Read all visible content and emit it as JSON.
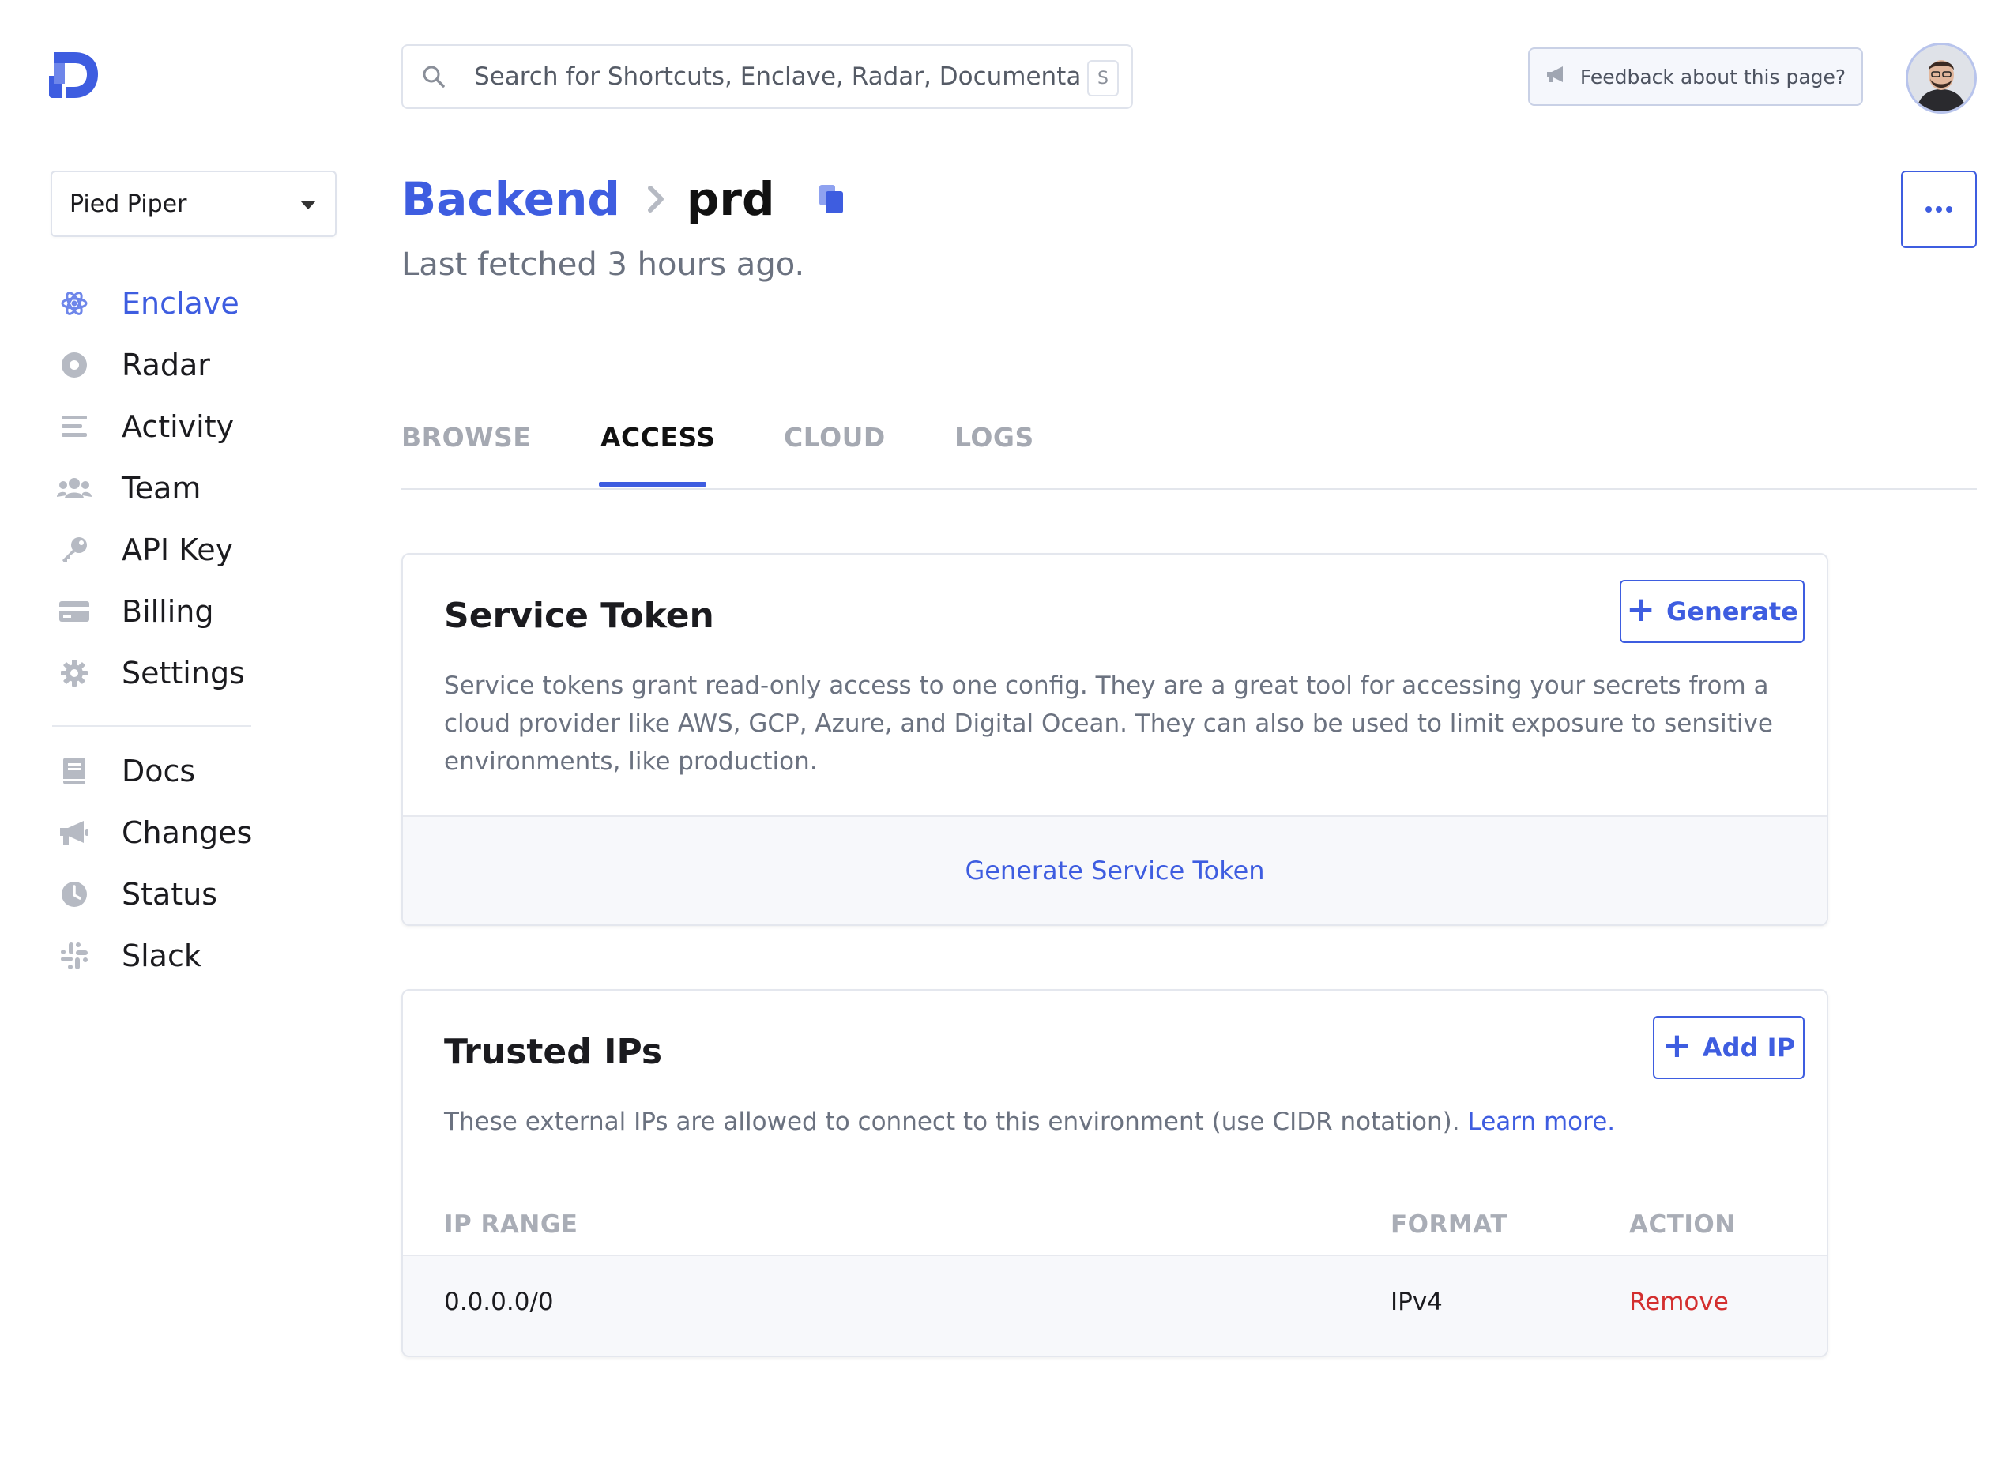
{
  "search": {
    "placeholder": "Search for Shortcuts, Enclave, Radar, Documentation...",
    "shortcut": "S"
  },
  "header": {
    "feedback_label": "Feedback about this page?"
  },
  "org_selector": {
    "selected": "Pied Piper"
  },
  "sidebar": {
    "items": [
      {
        "label": "Enclave",
        "icon": "atom-icon",
        "active": true
      },
      {
        "label": "Radar",
        "icon": "radar-icon"
      },
      {
        "label": "Activity",
        "icon": "activity-list-icon"
      },
      {
        "label": "Team",
        "icon": "team-icon"
      },
      {
        "label": "API Key",
        "icon": "key-icon"
      },
      {
        "label": "Billing",
        "icon": "credit-card-icon"
      },
      {
        "label": "Settings",
        "icon": "gear-icon"
      }
    ],
    "secondary": [
      {
        "label": "Docs",
        "icon": "book-icon"
      },
      {
        "label": "Changes",
        "icon": "megaphone-icon"
      },
      {
        "label": "Status",
        "icon": "clock-icon"
      },
      {
        "label": "Slack",
        "icon": "slack-icon"
      }
    ]
  },
  "breadcrumb": {
    "project": "Backend",
    "environment": "prd"
  },
  "last_fetched": "Last fetched 3 hours ago.",
  "tabs": [
    {
      "label": "BROWSE"
    },
    {
      "label": "ACCESS",
      "active": true
    },
    {
      "label": "CLOUD"
    },
    {
      "label": "LOGS"
    }
  ],
  "service_token": {
    "title": "Service Token",
    "button": "Generate",
    "description": "Service tokens grant read-only access to one config. They are a great tool for accessing your secrets from a cloud provider like AWS, GCP, Azure, and Digital Ocean. They can also be used to limit exposure to sensitive environments, like production.",
    "footer_link": "Generate Service Token"
  },
  "trusted_ips": {
    "title": "Trusted IPs",
    "button": "Add IP",
    "description": "These external IPs are allowed to connect to this environment (use CIDR notation).",
    "learn_more": "Learn more.",
    "columns": [
      "IP RANGE",
      "FORMAT",
      "ACTION"
    ],
    "rows": [
      {
        "ip_range": "0.0.0.0/0",
        "format": "IPv4",
        "action": "Remove"
      }
    ]
  },
  "colors": {
    "accent": "#3e5de0",
    "danger": "#d32f2f",
    "muted": "#6b7280"
  }
}
